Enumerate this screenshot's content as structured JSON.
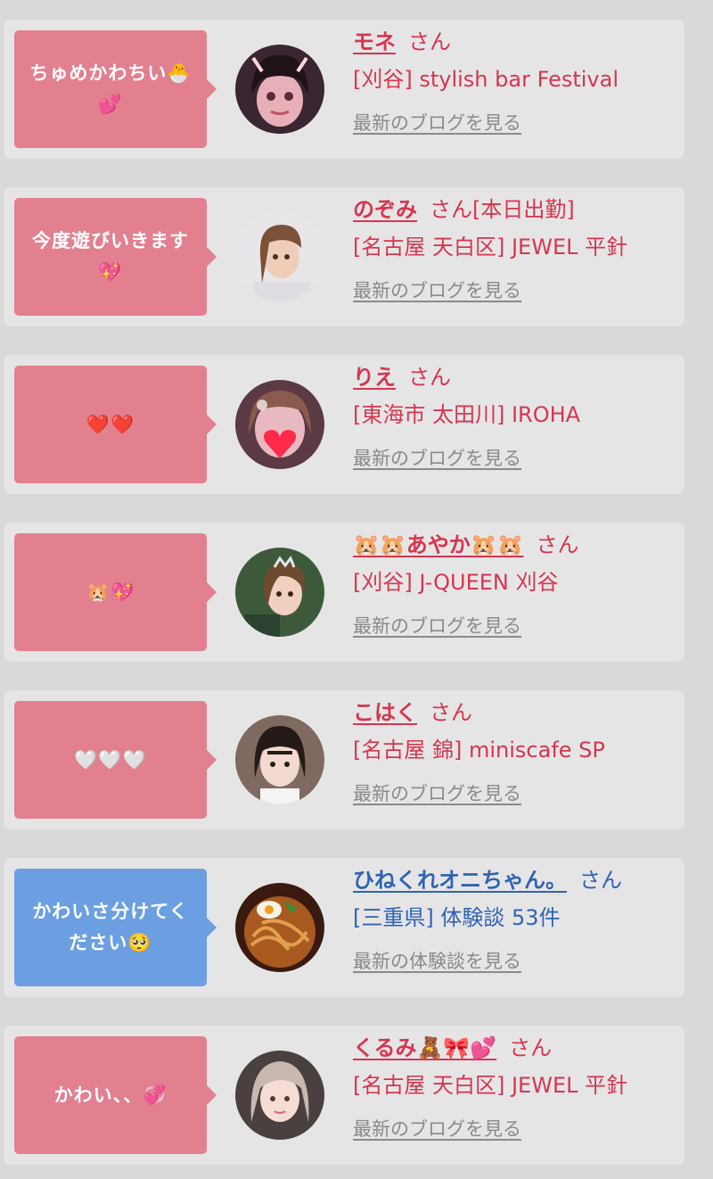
{
  "colors": {
    "pink_bubble": "#e2808f",
    "blue_bubble": "#6b9fe2",
    "pink_text": "#d6364f",
    "blue_text": "#2f63b4",
    "card_bg": "#e6e5e6",
    "link_gray": "#8a8a8a"
  },
  "cards": [
    {
      "bubble_line1": "ちゅめかわちい🐣",
      "bubble_line2": "💕",
      "name": "モネ",
      "suffix": "さん",
      "shop": "[刈谷] stylish bar Festival",
      "link": "最新のブログを見る",
      "avatar_icon": "girl-avatar-icon"
    },
    {
      "bubble_line1": "今度遊びいきます",
      "bubble_line2": "💖",
      "name": "のぞみ",
      "suffix": "さん[本日出勤]",
      "shop": "[名古屋 天白区] JEWEL 平針",
      "link": "最新のブログを見る",
      "avatar_icon": "girl-avatar-icon"
    },
    {
      "bubble_line1": "❤️❤️",
      "bubble_line2": "",
      "name": "りえ",
      "suffix": "さん",
      "shop": "[東海市 太田川] IROHA",
      "link": "最新のブログを見る",
      "avatar_icon": "girl-avatar-icon"
    },
    {
      "bubble_line1": "🐹💖",
      "bubble_line2": "",
      "name": "🐹🐹あやか🐹🐹",
      "suffix": "さん",
      "shop": "[刈谷] J-QUEEN 刈谷",
      "link": "最新のブログを見る",
      "avatar_icon": "girl-avatar-icon"
    },
    {
      "bubble_line1": "🤍🤍🤍",
      "bubble_line2": "",
      "name": "こはく",
      "suffix": "さん",
      "shop": "[名古屋 錦] miniscafe SP",
      "link": "最新のブログを見る",
      "avatar_icon": "girl-avatar-icon"
    },
    {
      "bubble_line1": "かわいさ分けてく",
      "bubble_line2": "ださい🥺",
      "name": "ひねくれオニちゃん。",
      "suffix": "さん",
      "shop": "[三重県] 体験談 53件",
      "link": "最新の体験談を見る",
      "avatar_icon": "noodles-avatar-icon"
    },
    {
      "bubble_line1": "かわい、、💞",
      "bubble_line2": "",
      "name": "くるみ🧸🎀💕",
      "suffix": "さん",
      "shop": "[名古屋 天白区] JEWEL 平針",
      "link": "最新のブログを見る",
      "avatar_icon": "girl-avatar-icon"
    }
  ]
}
